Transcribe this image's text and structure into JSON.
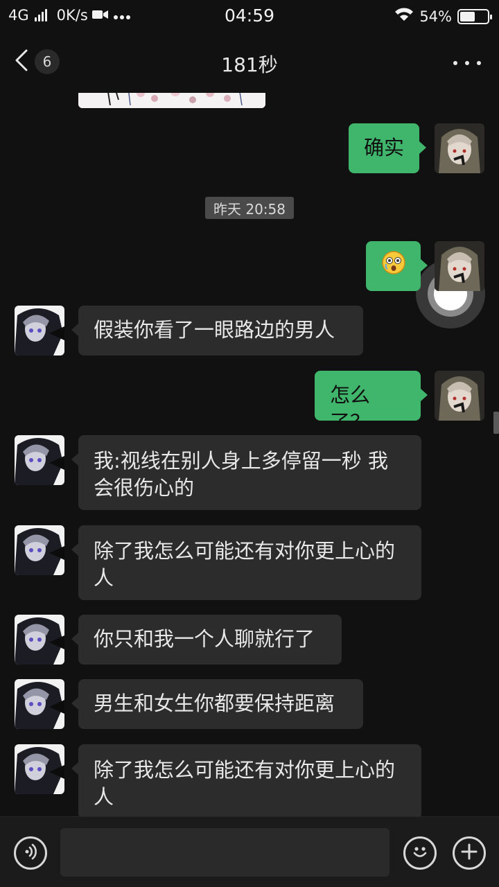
{
  "status_bar": {
    "network": "4G",
    "speed": "0K/s",
    "time": "04:59",
    "battery_text": "54%",
    "battery_level": 0.54,
    "icons": [
      "signal-icon",
      "video-icon",
      "more-notifications-icon",
      "wifi-icon",
      "battery-icon"
    ]
  },
  "header": {
    "unread_count": "6",
    "title": "181秒",
    "back_icon": "chevron-left-icon",
    "more_icon": "more-dots-icon"
  },
  "timestamp": "昨天 20:58",
  "messages": {
    "m1": {
      "side": "out",
      "text": "确实"
    },
    "m2": {
      "side": "out",
      "text": "😮",
      "kind": "emoji",
      "emoji_icon": "surprised-tearful-emoji-icon"
    },
    "m3": {
      "side": "in",
      "text": "假装你看了一眼路边的男人"
    },
    "m4": {
      "side": "out",
      "text": "怎么了？"
    },
    "m5": {
      "side": "in",
      "text": "我:视线在别人身上多停留一秒 我会很伤心的"
    },
    "m6": {
      "side": "in",
      "text": "除了我怎么可能还有对你更上心的人"
    },
    "m7": {
      "side": "in",
      "text": "你只和我一个人聊就行了"
    },
    "m8": {
      "side": "in",
      "text": "男生和女生你都要保持距离"
    },
    "m9": {
      "side": "in",
      "text": "除了我怎么可能还有对你更上心的人"
    }
  },
  "input_bar": {
    "value": "",
    "placeholder": "",
    "voice_icon": "voice-icon",
    "emoji_icon": "smiley-icon",
    "plus_icon": "plus-icon"
  },
  "colors": {
    "background": "#111111",
    "bubble_in": "#2c2c2c",
    "bubble_out": "#3fb66b",
    "timestamp_bg": "#4a4a4a"
  }
}
